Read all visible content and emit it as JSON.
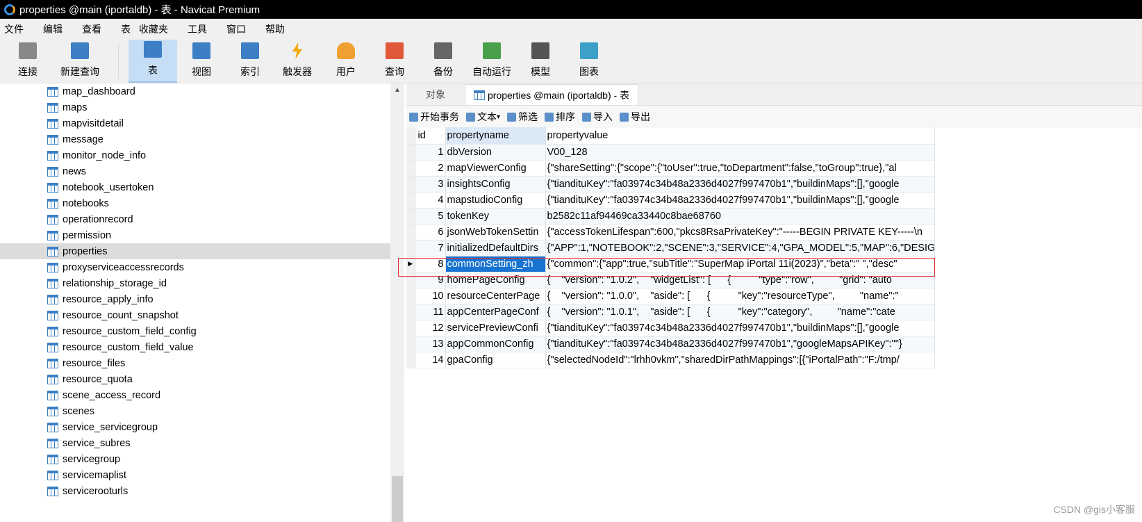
{
  "window": {
    "title": "properties @main (iportaldb) - 表 - Navicat Premium"
  },
  "menu": [
    "文件",
    "编辑",
    "查看",
    "表",
    "收藏夹",
    "工具",
    "窗口",
    "帮助"
  ],
  "toolbar": [
    {
      "label": "连接",
      "icon": "connection-plug-icon",
      "color": "#888888"
    },
    {
      "label": "新建查询",
      "icon": "new-query-icon",
      "color": "#3d7fc4"
    },
    {
      "label": "表",
      "icon": "table-icon",
      "color": "#3d7fc4",
      "active": true
    },
    {
      "label": "视图",
      "icon": "view-icon",
      "color": "#3d7fc4"
    },
    {
      "label": "索引",
      "icon": "index-az-icon",
      "color": "#3d7fc4"
    },
    {
      "label": "触发器",
      "icon": "trigger-lightning-icon",
      "color": "#f5a800"
    },
    {
      "label": "用户",
      "icon": "user-icon",
      "color": "#f0a030"
    },
    {
      "label": "查询",
      "icon": "query-icon",
      "color": "#e05a3a"
    },
    {
      "label": "备份",
      "icon": "backup-icon",
      "color": "#666666"
    },
    {
      "label": "自动运行",
      "icon": "automation-icon",
      "color": "#4aa04a"
    },
    {
      "label": "模型",
      "icon": "model-icon",
      "color": "#555555"
    },
    {
      "label": "图表",
      "icon": "chart-icon",
      "color": "#3da0c8"
    }
  ],
  "tree": [
    "map_dashboard",
    "maps",
    "mapvisitdetail",
    "message",
    "monitor_node_info",
    "news",
    "notebook_usertoken",
    "notebooks",
    "operationrecord",
    "permission",
    "properties",
    "proxyserviceaccessrecords",
    "relationship_storage_id",
    "resource_apply_info",
    "resource_count_snapshot",
    "resource_custom_field_config",
    "resource_custom_field_value",
    "resource_files",
    "resource_quota",
    "scene_access_record",
    "scenes",
    "service_servicegroup",
    "service_subres",
    "servicegroup",
    "servicemaplist",
    "servicerooturls"
  ],
  "tree_selected": "properties",
  "tabs": [
    "对象",
    "properties @main (iportaldb) - 表"
  ],
  "subtoolbar": [
    "开始事务",
    "文本",
    "筛选",
    "排序",
    "导入",
    "导出"
  ],
  "grid": {
    "columns": [
      "id",
      "propertyname",
      "propertyvalue"
    ],
    "rows": [
      [
        "1",
        "dbVersion",
        "V00_128"
      ],
      [
        "2",
        "mapViewerConfig",
        "{\"shareSetting\":{\"scope\":{\"toUser\":true,\"toDepartment\":false,\"toGroup\":true},\"al"
      ],
      [
        "3",
        "insightsConfig",
        "{\"tiandituKey\":\"fa03974c34b48a2336d4027f997470b1\",\"buildinMaps\":[],\"google"
      ],
      [
        "4",
        "mapstudioConfig",
        "{\"tiandituKey\":\"fa03974c34b48a2336d4027f997470b1\",\"buildinMaps\":[],\"google"
      ],
      [
        "5",
        "tokenKey",
        "b2582c11af94469ca33440c8bae68760"
      ],
      [
        "6",
        "jsonWebTokenSettin",
        "{\"accessTokenLifespan\":600,\"pkcs8RsaPrivateKey\":\"-----BEGIN PRIVATE KEY-----\\n"
      ],
      [
        "7",
        "initializedDefaultDirs",
        "{\"APP\":1,\"NOTEBOOK\":2,\"SCENE\":3,\"SERVICE\":4,\"GPA_MODEL\":5,\"MAP\":6,\"DESIG"
      ],
      [
        "8",
        "commonSetting_zh",
        "{\"common\":{\"app\":true,\"subTitle\":\"SuperMap iPortal 11i(2023)\",\"beta\":\" \",\"desc\""
      ],
      [
        "9",
        "homePageConfig",
        "{    \"version\": \"1.0.2\",    \"widgetList\": [      {          \"type\":\"row\",         \"grid\": \"auto"
      ],
      [
        "10",
        "resourceCenterPage",
        "{    \"version\": \"1.0.0\",    \"aside\": [      {          \"key\":\"resourceType\",         \"name\":\""
      ],
      [
        "11",
        "appCenterPageConf",
        "{    \"version\": \"1.0.1\",    \"aside\": [      {          \"key\":\"category\",         \"name\":\"cate"
      ],
      [
        "12",
        "servicePreviewConfi",
        "{\"tiandituKey\":\"fa03974c34b48a2336d4027f997470b1\",\"buildinMaps\":[],\"google"
      ],
      [
        "13",
        "appCommonConfig",
        "{\"tiandituKey\":\"fa03974c34b48a2336d4027f997470b1\",\"googleMapsAPIKey\":\"\"}"
      ],
      [
        "14",
        "gpaConfig",
        "{\"selectedNodeId\":\"lrhh0vkm\",\"sharedDirPathMappings\":[{\"iPortalPath\":\"F:/tmp/"
      ]
    ],
    "selected_row": "8"
  },
  "watermark": "CSDN @gis小客服"
}
